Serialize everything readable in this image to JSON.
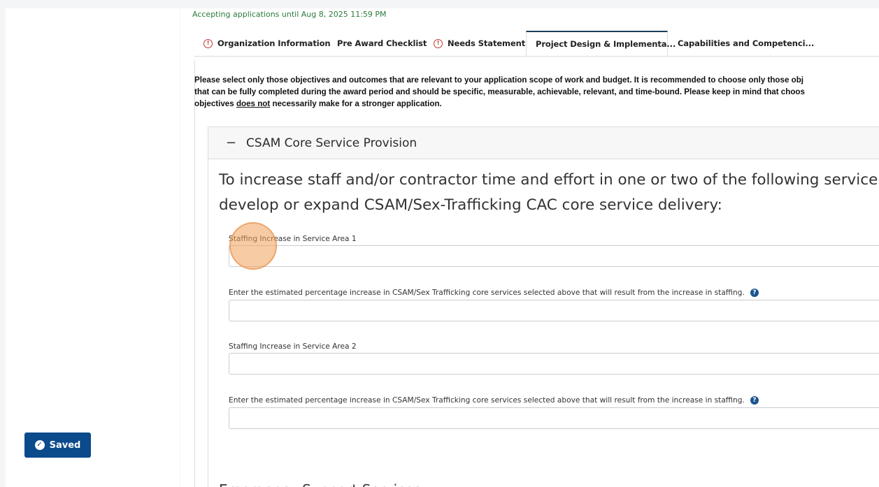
{
  "status": {
    "saved_label": "Saved"
  },
  "application": {
    "deadline_text": "Accepting applications until Aug 8, 2025 11:59 PM"
  },
  "tabs": [
    {
      "label": "Organization Information",
      "warning": true
    },
    {
      "label": "Pre Award Checklist",
      "warning": false
    },
    {
      "label": "Needs Statement",
      "warning": true
    },
    {
      "label": "Project Design & Implementa...",
      "warning": false,
      "active": true
    },
    {
      "label": "Capabilities and Competenci...",
      "warning": false
    }
  ],
  "instructions": {
    "line1": "Please select only those objectives and outcomes that are relevant to your application scope of work and budget. It is recommended to choose only those obj",
    "line2": "that can be fully completed during the award period and should be specific, measurable, achievable, relevant, and time-bound. Please keep in mind that choos",
    "line3_pre": "objectives ",
    "line3_under": "does not",
    "line3_post": " necessarily make for a stronger application."
  },
  "section": {
    "title": "CSAM Core Service Provision",
    "question_line1": "To increase staff and/or contractor time and effort in one or two of the following service area",
    "question_line2": "develop or expand CSAM/Sex-Trafficking CAC core service delivery:",
    "fields": [
      {
        "label": "Staffing Increase in Service Area 1",
        "value": "",
        "help": false
      },
      {
        "label": "Enter the estimated percentage increase in CSAM/Sex Trafficking core services selected above that will result from the increase in staffing.",
        "value": "",
        "help": true
      },
      {
        "label": "Staffing Increase in Service Area 2",
        "value": "",
        "help": false
      },
      {
        "label": "Enter the estimated percentage increase in CSAM/Sex Trafficking core services selected above that will result from the increase in staffing.",
        "value": "",
        "help": true
      }
    ]
  },
  "next_section": {
    "title": "Emergency Support Services"
  },
  "colors": {
    "primary": "#0b4a8b",
    "success_text": "#2a7a3a",
    "warning": "#c0392b"
  }
}
